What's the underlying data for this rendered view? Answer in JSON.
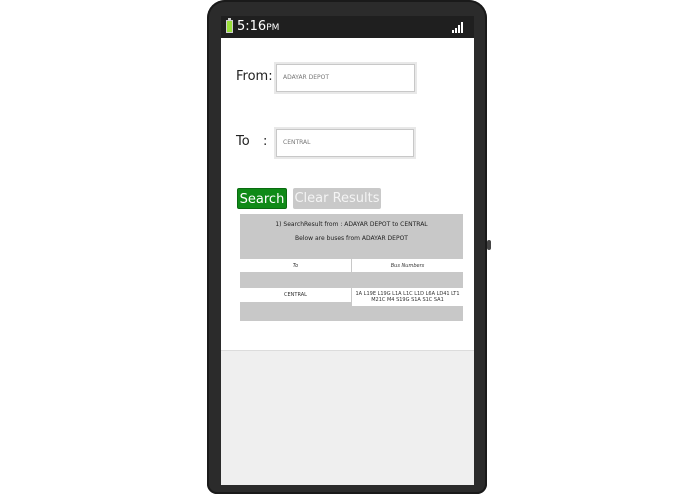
{
  "status_bar": {
    "time": "5:16",
    "time_suffix": "PM",
    "battery_color": "#9adf3a"
  },
  "form": {
    "from_label": "From:",
    "from_value": "ADAYAR DEPOT",
    "to_label": "To",
    "to_colon": ":",
    "to_value": "CENTRAL"
  },
  "buttons": {
    "search_label": "Search",
    "clear_label": "Clear Results",
    "search_color": "#0f8a17"
  },
  "results": {
    "summary": "1) SearchResult from : ADAYAR DEPOT to CENTRAL",
    "subtitle": "Below are buses from ADAYAR DEPOT",
    "columns": [
      "To",
      "Bus Numbers"
    ],
    "rows": [
      {
        "to": "CENTRAL",
        "bus_numbers": "1A L19E L19G L1A L1C L1D L6A LD41 LT1 M21C M4 S19G S1A S1C SA1"
      }
    ]
  }
}
